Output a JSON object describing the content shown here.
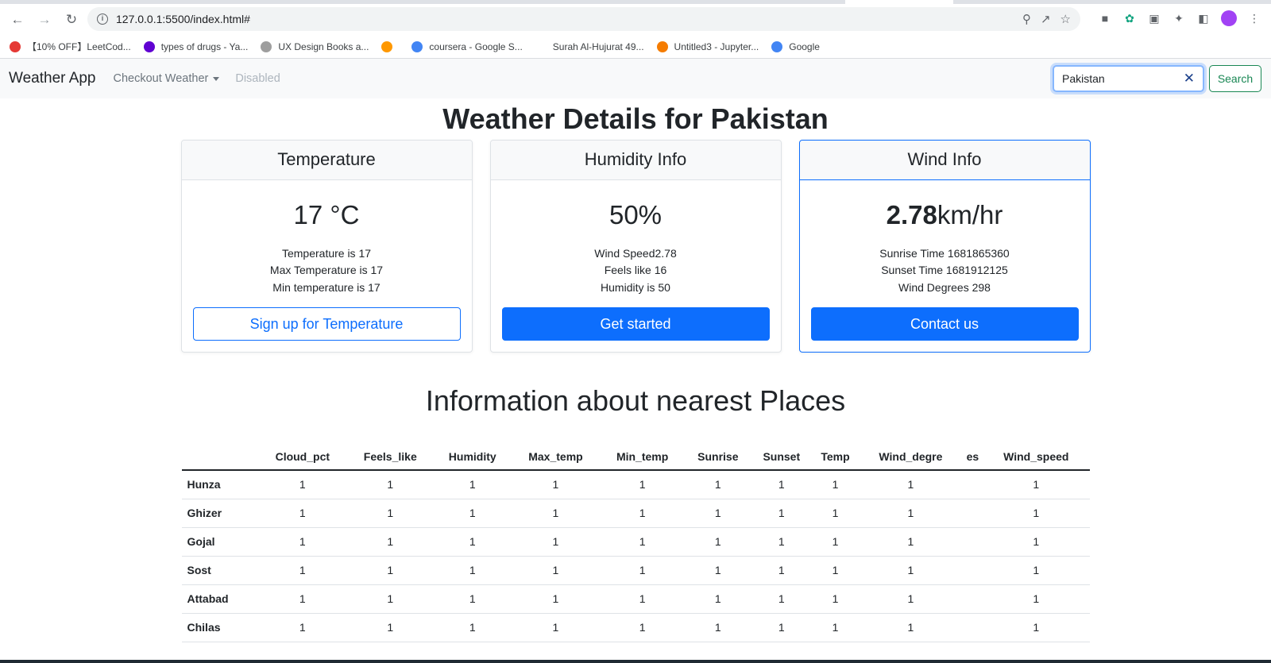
{
  "browser": {
    "url": "127.0.0.1:5500/index.html#",
    "bookmarks": [
      {
        "label": "【10% OFF】LeetCod...",
        "color": "#e53935"
      },
      {
        "label": "types of drugs - Ya...",
        "color": "#6001d2"
      },
      {
        "label": "UX Design Books a...",
        "color": "#9e9e9e"
      },
      {
        "label": "",
        "color": "#ff9800"
      },
      {
        "label": "coursera - Google S...",
        "color": "#4285f4"
      },
      {
        "label": "Surah Al-Hujurat 49...",
        "color": "#ffffff"
      },
      {
        "label": "Untitled3 - Jupyter...",
        "color": "#f57c00"
      },
      {
        "label": "Google",
        "color": "#4285f4"
      }
    ]
  },
  "navbar": {
    "brand": "Weather App",
    "dropdown_label": "Checkout Weather",
    "disabled_label": "Disabled",
    "search_value": "Pakistan",
    "search_button": "Search"
  },
  "page_title": "Weather Details for Pakistan",
  "cards": {
    "temperature": {
      "header": "Temperature",
      "value": "17 °C",
      "lines": [
        "Temperature is 17",
        "Max Temperature is 17",
        "Min temperature is 17"
      ],
      "button": "Sign up for Temperature"
    },
    "humidity": {
      "header": "Humidity Info",
      "value": "50%",
      "lines": [
        "Wind Speed2.78",
        "Feels like 16",
        "Humidity is 50"
      ],
      "button": "Get started"
    },
    "wind": {
      "header": "Wind Info",
      "value_bold": "2.78",
      "value_unit": "km/hr",
      "lines": [
        "Sunrise Time 1681865360",
        "Sunset Time 1681912125",
        "Wind Degrees 298"
      ],
      "button": "Contact us"
    }
  },
  "places": {
    "title": "Information about nearest Places",
    "columns": [
      "",
      "Cloud_pct",
      "Feels_like",
      "Humidity",
      "Max_temp",
      "Min_temp",
      "Sunrise",
      "Sunset",
      "Temp",
      "Wind_degre",
      "es",
      "Wind_speed"
    ],
    "rows": [
      {
        "name": "Hunza",
        "values": [
          "1",
          "1",
          "1",
          "1",
          "1",
          "1",
          "1",
          "1",
          "1",
          "",
          "1"
        ]
      },
      {
        "name": "Ghizer",
        "values": [
          "1",
          "1",
          "1",
          "1",
          "1",
          "1",
          "1",
          "1",
          "1",
          "",
          "1"
        ]
      },
      {
        "name": "Gojal",
        "values": [
          "1",
          "1",
          "1",
          "1",
          "1",
          "1",
          "1",
          "1",
          "1",
          "",
          "1"
        ]
      },
      {
        "name": "Sost",
        "values": [
          "1",
          "1",
          "1",
          "1",
          "1",
          "1",
          "1",
          "1",
          "1",
          "",
          "1"
        ]
      },
      {
        "name": "Attabad",
        "values": [
          "1",
          "1",
          "1",
          "1",
          "1",
          "1",
          "1",
          "1",
          "1",
          "",
          "1"
        ]
      },
      {
        "name": "Chilas",
        "values": [
          "1",
          "1",
          "1",
          "1",
          "1",
          "1",
          "1",
          "1",
          "1",
          "",
          "1"
        ]
      }
    ]
  }
}
